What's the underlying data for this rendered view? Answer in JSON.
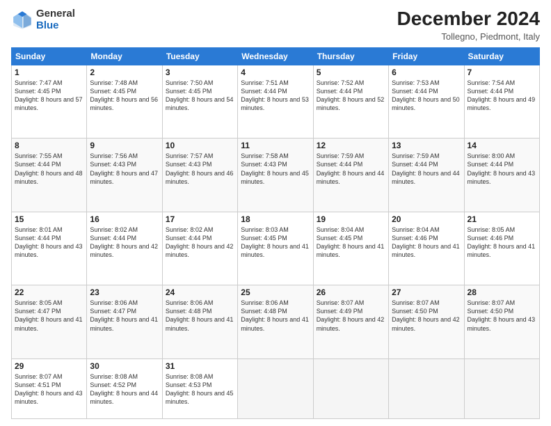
{
  "header": {
    "logo_general": "General",
    "logo_blue": "Blue",
    "month_title": "December 2024",
    "location": "Tollegno, Piedmont, Italy"
  },
  "weekdays": [
    "Sunday",
    "Monday",
    "Tuesday",
    "Wednesday",
    "Thursday",
    "Friday",
    "Saturday"
  ],
  "weeks": [
    [
      {
        "day": "1",
        "sunrise": "Sunrise: 7:47 AM",
        "sunset": "Sunset: 4:45 PM",
        "daylight": "Daylight: 8 hours and 57 minutes."
      },
      {
        "day": "2",
        "sunrise": "Sunrise: 7:48 AM",
        "sunset": "Sunset: 4:45 PM",
        "daylight": "Daylight: 8 hours and 56 minutes."
      },
      {
        "day": "3",
        "sunrise": "Sunrise: 7:50 AM",
        "sunset": "Sunset: 4:45 PM",
        "daylight": "Daylight: 8 hours and 54 minutes."
      },
      {
        "day": "4",
        "sunrise": "Sunrise: 7:51 AM",
        "sunset": "Sunset: 4:44 PM",
        "daylight": "Daylight: 8 hours and 53 minutes."
      },
      {
        "day": "5",
        "sunrise": "Sunrise: 7:52 AM",
        "sunset": "Sunset: 4:44 PM",
        "daylight": "Daylight: 8 hours and 52 minutes."
      },
      {
        "day": "6",
        "sunrise": "Sunrise: 7:53 AM",
        "sunset": "Sunset: 4:44 PM",
        "daylight": "Daylight: 8 hours and 50 minutes."
      },
      {
        "day": "7",
        "sunrise": "Sunrise: 7:54 AM",
        "sunset": "Sunset: 4:44 PM",
        "daylight": "Daylight: 8 hours and 49 minutes."
      }
    ],
    [
      {
        "day": "8",
        "sunrise": "Sunrise: 7:55 AM",
        "sunset": "Sunset: 4:44 PM",
        "daylight": "Daylight: 8 hours and 48 minutes."
      },
      {
        "day": "9",
        "sunrise": "Sunrise: 7:56 AM",
        "sunset": "Sunset: 4:43 PM",
        "daylight": "Daylight: 8 hours and 47 minutes."
      },
      {
        "day": "10",
        "sunrise": "Sunrise: 7:57 AM",
        "sunset": "Sunset: 4:43 PM",
        "daylight": "Daylight: 8 hours and 46 minutes."
      },
      {
        "day": "11",
        "sunrise": "Sunrise: 7:58 AM",
        "sunset": "Sunset: 4:43 PM",
        "daylight": "Daylight: 8 hours and 45 minutes."
      },
      {
        "day": "12",
        "sunrise": "Sunrise: 7:59 AM",
        "sunset": "Sunset: 4:44 PM",
        "daylight": "Daylight: 8 hours and 44 minutes."
      },
      {
        "day": "13",
        "sunrise": "Sunrise: 7:59 AM",
        "sunset": "Sunset: 4:44 PM",
        "daylight": "Daylight: 8 hours and 44 minutes."
      },
      {
        "day": "14",
        "sunrise": "Sunrise: 8:00 AM",
        "sunset": "Sunset: 4:44 PM",
        "daylight": "Daylight: 8 hours and 43 minutes."
      }
    ],
    [
      {
        "day": "15",
        "sunrise": "Sunrise: 8:01 AM",
        "sunset": "Sunset: 4:44 PM",
        "daylight": "Daylight: 8 hours and 43 minutes."
      },
      {
        "day": "16",
        "sunrise": "Sunrise: 8:02 AM",
        "sunset": "Sunset: 4:44 PM",
        "daylight": "Daylight: 8 hours and 42 minutes."
      },
      {
        "day": "17",
        "sunrise": "Sunrise: 8:02 AM",
        "sunset": "Sunset: 4:44 PM",
        "daylight": "Daylight: 8 hours and 42 minutes."
      },
      {
        "day": "18",
        "sunrise": "Sunrise: 8:03 AM",
        "sunset": "Sunset: 4:45 PM",
        "daylight": "Daylight: 8 hours and 41 minutes."
      },
      {
        "day": "19",
        "sunrise": "Sunrise: 8:04 AM",
        "sunset": "Sunset: 4:45 PM",
        "daylight": "Daylight: 8 hours and 41 minutes."
      },
      {
        "day": "20",
        "sunrise": "Sunrise: 8:04 AM",
        "sunset": "Sunset: 4:46 PM",
        "daylight": "Daylight: 8 hours and 41 minutes."
      },
      {
        "day": "21",
        "sunrise": "Sunrise: 8:05 AM",
        "sunset": "Sunset: 4:46 PM",
        "daylight": "Daylight: 8 hours and 41 minutes."
      }
    ],
    [
      {
        "day": "22",
        "sunrise": "Sunrise: 8:05 AM",
        "sunset": "Sunset: 4:47 PM",
        "daylight": "Daylight: 8 hours and 41 minutes."
      },
      {
        "day": "23",
        "sunrise": "Sunrise: 8:06 AM",
        "sunset": "Sunset: 4:47 PM",
        "daylight": "Daylight: 8 hours and 41 minutes."
      },
      {
        "day": "24",
        "sunrise": "Sunrise: 8:06 AM",
        "sunset": "Sunset: 4:48 PM",
        "daylight": "Daylight: 8 hours and 41 minutes."
      },
      {
        "day": "25",
        "sunrise": "Sunrise: 8:06 AM",
        "sunset": "Sunset: 4:48 PM",
        "daylight": "Daylight: 8 hours and 41 minutes."
      },
      {
        "day": "26",
        "sunrise": "Sunrise: 8:07 AM",
        "sunset": "Sunset: 4:49 PM",
        "daylight": "Daylight: 8 hours and 42 minutes."
      },
      {
        "day": "27",
        "sunrise": "Sunrise: 8:07 AM",
        "sunset": "Sunset: 4:50 PM",
        "daylight": "Daylight: 8 hours and 42 minutes."
      },
      {
        "day": "28",
        "sunrise": "Sunrise: 8:07 AM",
        "sunset": "Sunset: 4:50 PM",
        "daylight": "Daylight: 8 hours and 43 minutes."
      }
    ],
    [
      {
        "day": "29",
        "sunrise": "Sunrise: 8:07 AM",
        "sunset": "Sunset: 4:51 PM",
        "daylight": "Daylight: 8 hours and 43 minutes."
      },
      {
        "day": "30",
        "sunrise": "Sunrise: 8:08 AM",
        "sunset": "Sunset: 4:52 PM",
        "daylight": "Daylight: 8 hours and 44 minutes."
      },
      {
        "day": "31",
        "sunrise": "Sunrise: 8:08 AM",
        "sunset": "Sunset: 4:53 PM",
        "daylight": "Daylight: 8 hours and 45 minutes."
      },
      null,
      null,
      null,
      null
    ]
  ]
}
